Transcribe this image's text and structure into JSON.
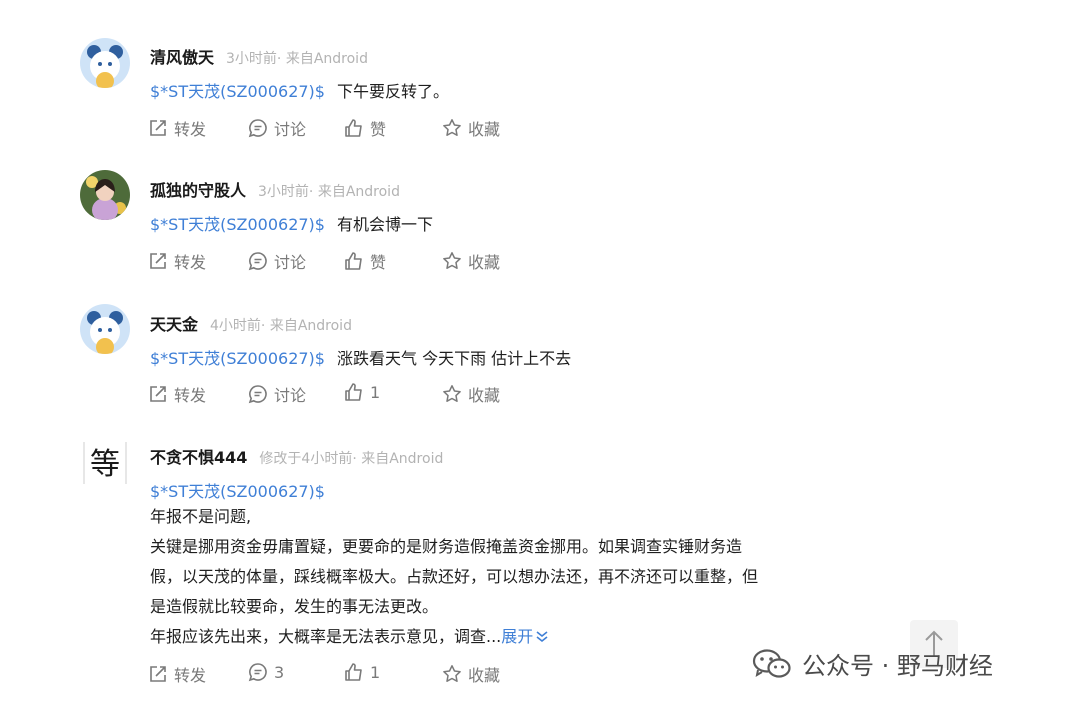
{
  "comments": [
    {
      "username": "清风傲天",
      "meta": "3小时前· 来自Android",
      "stock": "$*ST天茂(SZ000627)$",
      "text": "下午要反转了。",
      "actions": {
        "forward": "转发",
        "comment": "讨论",
        "like": "赞",
        "fav": "收藏"
      }
    },
    {
      "username": "孤独的守股人",
      "meta": "3小时前· 来自Android",
      "stock": "$*ST天茂(SZ000627)$",
      "text": "有机会博一下",
      "actions": {
        "forward": "转发",
        "comment": "讨论",
        "like": "赞",
        "fav": "收藏"
      }
    },
    {
      "username": "天天金",
      "meta": "4小时前· 来自Android",
      "stock": "$*ST天茂(SZ000627)$",
      "text": "涨跌看天气 今天下雨 估计上不去",
      "actions": {
        "forward": "转发",
        "comment": "讨论",
        "like": "1",
        "fav": "收藏"
      }
    },
    {
      "username": "不贪不惧444",
      "meta": "修改于4小时前· 来自Android",
      "avatar_char": "等",
      "stock": "$*ST天茂(SZ000627)$",
      "lines": [
        "年报不是问题,",
        "关键是挪用资金毋庸置疑，更要命的是财务造假掩盖资金挪用。如果调查实锤财务造",
        "假，以天茂的体量，踩线概率极大。占款还好，可以想办法还，再不济还可以重整，但",
        "是造假就比较要命，发生的事无法更改。",
        "年报应该先出来，大概率是无法表示意见，调查..."
      ],
      "expand": "展开",
      "actions": {
        "forward": "转发",
        "comment": "3",
        "like": "1",
        "fav": "收藏"
      }
    }
  ],
  "watermark": {
    "text": "公众号 · 野马财经"
  },
  "colors": {
    "link": "#3f7fd6",
    "meta": "#b3b3b3",
    "action": "#7a7a7a"
  }
}
